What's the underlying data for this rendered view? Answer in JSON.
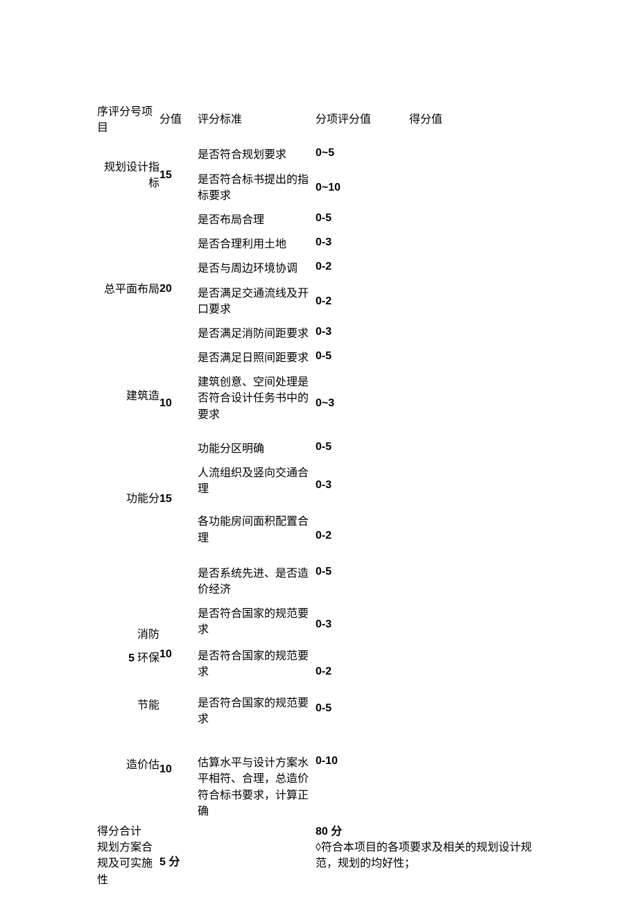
{
  "header": {
    "col1": "序评分号项目",
    "col2": "分值",
    "col3": "评分标准",
    "col4": "分项评分值",
    "col5": "得分值"
  },
  "rows": {
    "r1": {
      "cat": "规划设计指标",
      "score": "15",
      "c1": "是否符合规划要求",
      "s1": "0~5",
      "c2": "是否符合标书提出的指标要求",
      "s2": "0~10"
    },
    "r2": {
      "cat": "总平面布局",
      "score": "20",
      "c1": "是否布局合理",
      "s1": "0-5",
      "c2": "是否合理利用土地",
      "s2": "0-3",
      "c3": "是否与周边环境协调",
      "s3": "0-2",
      "c4": "是否满足交通流线及开口要求",
      "s4": "0-2",
      "c5": "是否满足消防间距要求",
      "s5": "0-3",
      "c6": "是否满足日照间距要求",
      "s6": "0-5"
    },
    "r3": {
      "cat": "建筑造",
      "score": "10",
      "c1": "建筑创意、空间处理是否符合设计任务书中的要求",
      "s1": "0~3"
    },
    "r4": {
      "cat": "功能分",
      "score": "15",
      "c1": "功能分区明确",
      "s1": "0-5",
      "c2": "人流组织及竖向交通合理",
      "s2": "0-3",
      "c3": "各功能房间面积配置合理",
      "s3": "0-2"
    },
    "r5a": {
      "cat": "消防",
      "c1": "是否系统先进、是否造价经济",
      "s1": "0-5",
      "c2": "是否符合国家的规范要求",
      "s2": "0-3"
    },
    "r5b": {
      "cat_prefix": "5",
      "cat": "环保",
      "score": "10",
      "c1": "是否符合国家的规范要求",
      "s1": "0-2"
    },
    "r5c": {
      "cat": "节能",
      "c1": "是否符合国家的规范要求",
      "s1": "0-5"
    },
    "r6": {
      "cat": "造价估",
      "score": "10",
      "c1": "估算水平与设计方案水平相符、合理，总造价符合标书要求，计算正确",
      "s1": "0-10"
    },
    "total": {
      "label": "得分合计",
      "value": "80 分"
    },
    "plan": {
      "label": "规划方案合规及可实施性",
      "score": "5 分",
      "desc": "◊符合本项目的各项要求及相关的规划设计规范，规划的均好性；"
    }
  }
}
